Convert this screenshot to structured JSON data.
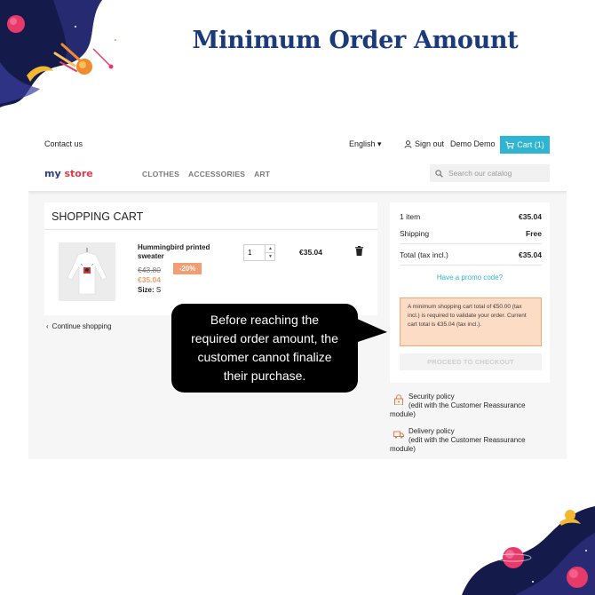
{
  "banner": {
    "title": "Minimum Order Amount"
  },
  "topbar": {
    "contact": "Contact us",
    "language": "English",
    "sign_out": "Sign out",
    "user": "Demo Demo",
    "cart": "Cart (1)"
  },
  "header": {
    "logo_part1": "my ",
    "logo_part2": "store",
    "nav": [
      "CLOTHES",
      "ACCESSORIES",
      "ART"
    ],
    "search_placeholder": "Search our catalog"
  },
  "cart": {
    "title": "SHOPPING CART",
    "item": {
      "name": "Hummingbird printed sweater",
      "old_price": "€43.80",
      "discount": "-20%",
      "price": "€35.04",
      "size_label": "Size:",
      "size_value": "S",
      "quantity": "1",
      "total": "€35.04"
    },
    "continue": "Continue shopping"
  },
  "summary": {
    "items_label": "1 item",
    "items_value": "€35.04",
    "shipping_label": "Shipping",
    "shipping_value": "Free",
    "total_label": "Total (tax incl.)",
    "total_value": "€35.04",
    "promo": "Have a promo code?",
    "alert": "A minimum shopping cart total of €50.00 (tax incl.) is required to validate your order. Current cart total is €35.04 (tax incl.).",
    "checkout": "PROCEED TO CHECKOUT"
  },
  "reassurance": [
    {
      "title": "Security policy",
      "line2": "(edit with the Customer Reassurance",
      "line3": "module)",
      "icon": "lock-icon"
    },
    {
      "title": "Delivery policy",
      "line2": "(edit with the Customer Reassurance",
      "line3": "module)",
      "icon": "truck-icon"
    }
  ],
  "callout": {
    "line1": "Before reaching the",
    "line2": "required order amount, the",
    "line3": "customer cannot finalize",
    "line4": "their purchase."
  },
  "colors": {
    "title": "#1b3a7a",
    "cart_button": "#2fb5d2",
    "discount": "#f39d72",
    "alert_bg": "#fcdcc5",
    "callout_bg": "#000000"
  }
}
